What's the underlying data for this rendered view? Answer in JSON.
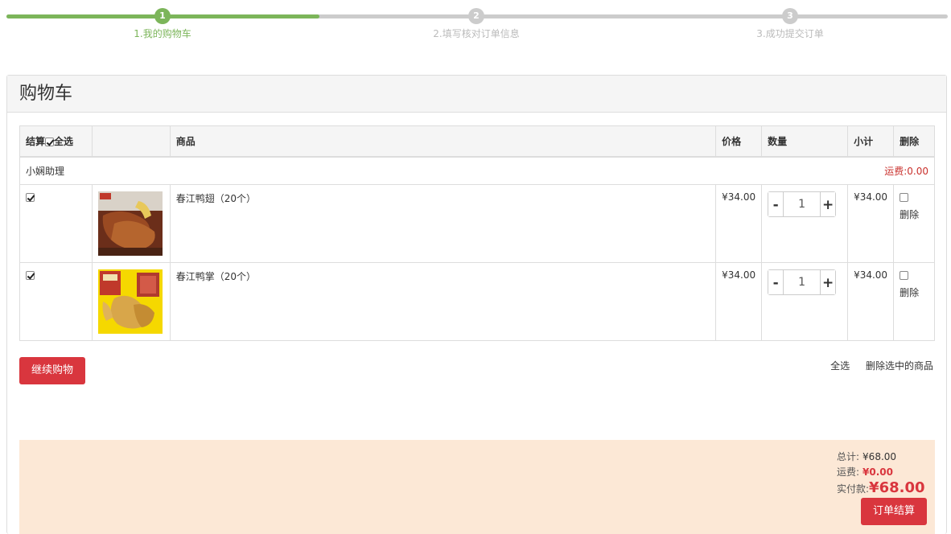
{
  "steps": [
    {
      "number": "1",
      "label": "1.我的购物车",
      "active": true
    },
    {
      "number": "2",
      "label": "2.填写核对订单信息",
      "active": false
    },
    {
      "number": "3",
      "label": "3.成功提交订单",
      "active": false
    }
  ],
  "panel_title": "购物车",
  "table": {
    "col_settle": "结算",
    "col_select_all": "全选",
    "col_product": "商品",
    "col_price": "价格",
    "col_qty": "数量",
    "col_subtotal": "小计",
    "col_delete": "删除"
  },
  "store": {
    "name": "小娴助理",
    "freight_label": "运费:",
    "freight_value": "0.00"
  },
  "items": [
    {
      "name": "春江鸭翅（20个）",
      "price": "¥34.00",
      "qty": "1",
      "subtotal": "¥34.00",
      "delete_label": "删除",
      "checked": true
    },
    {
      "name": "春江鸭掌（20个）",
      "price": "¥34.00",
      "qty": "1",
      "subtotal": "¥34.00",
      "delete_label": "删除",
      "checked": true
    }
  ],
  "stepper": {
    "minus": "-",
    "plus": "+"
  },
  "continue_label": "继续购物",
  "bulk": {
    "select_all": "全选",
    "delete_selected": "删除选中的商品"
  },
  "summary": {
    "total_label": "总计:",
    "total_value": "¥68.00",
    "freight_label": "运费:",
    "freight_value": "¥0.00",
    "pay_label": "实付款:",
    "pay_value": "¥68.00",
    "checkout_label": "订单结算"
  },
  "colors": {
    "accent_green": "#7cb55a",
    "accent_red": "#d9363e",
    "summary_bg": "#fce8d6"
  }
}
